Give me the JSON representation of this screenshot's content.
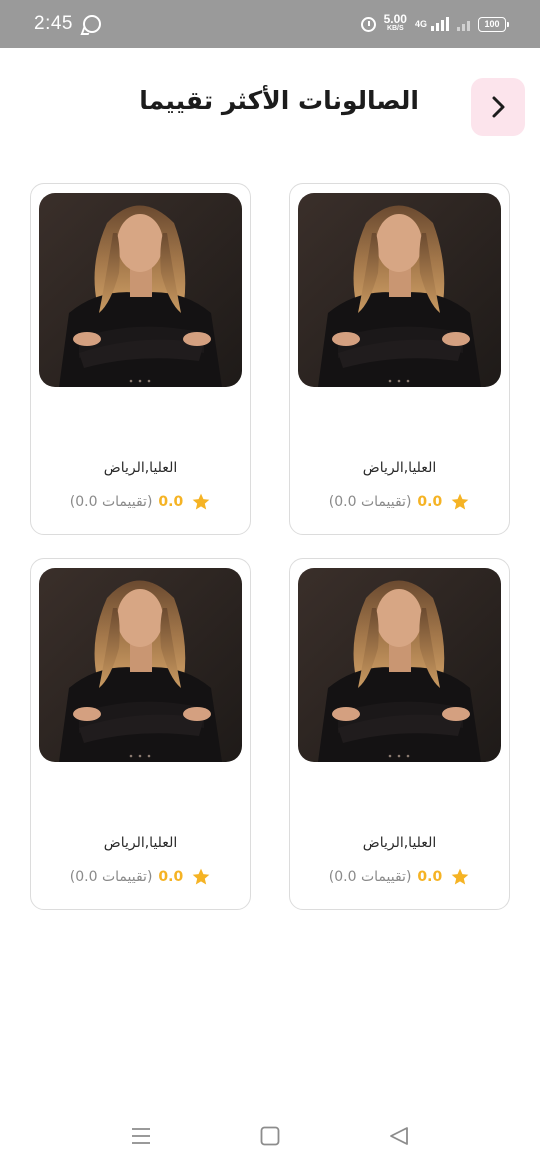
{
  "status_bar": {
    "time": "2:45",
    "speed_value": "5.00",
    "speed_unit": "KB/S",
    "network": "4G",
    "battery": "100",
    "icons": [
      "whatsapp-icon",
      "alarm-icon",
      "signal-icon",
      "battery-icon"
    ]
  },
  "header": {
    "title": "الصالونات الأكثر تقييما",
    "back_icon": "chevron-right-icon"
  },
  "cards": [
    {
      "location": "العليا,الرياض",
      "rating": "0.0",
      "ratings_count": "(0.0 تقييمات)"
    },
    {
      "location": "العليا,الرياض",
      "rating": "0.0",
      "ratings_count": "(0.0 تقييمات)"
    },
    {
      "location": "العليا,الرياض",
      "rating": "0.0",
      "ratings_count": "(0.0 تقييمات)"
    },
    {
      "location": "العليا,الرياض",
      "rating": "0.0",
      "ratings_count": "(0.0 تقييمات)"
    }
  ],
  "nav_bar": {
    "icons": [
      "menu-icon",
      "home-square-icon",
      "back-triangle-icon"
    ]
  },
  "colors": {
    "accent_pink": "#fce4ec",
    "star_gold": "#f5b324",
    "status_gray": "#9a9a9a"
  }
}
